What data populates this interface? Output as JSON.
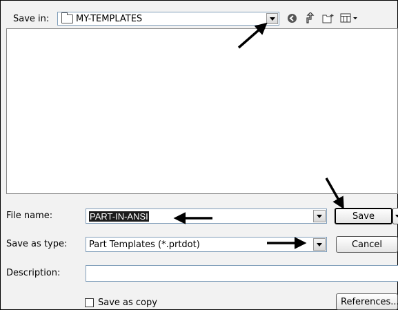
{
  "save_in": {
    "label": "Save in:",
    "value": "MY-TEMPLATES"
  },
  "toolbar": {
    "icons": [
      "back-icon",
      "up-folder-icon",
      "new-folder-icon",
      "views-menu-icon"
    ]
  },
  "file_name": {
    "label": "File name:",
    "value": "PART-IN-ANSI"
  },
  "save_as_type": {
    "label": "Save as type:",
    "value": "Part Templates (*.prtdot)"
  },
  "description": {
    "label": "Description:",
    "value": ""
  },
  "save_as_copy": {
    "label": "Save as copy",
    "checked": false
  },
  "buttons": {
    "save": "Save",
    "cancel": "Cancel",
    "references": "References..."
  }
}
